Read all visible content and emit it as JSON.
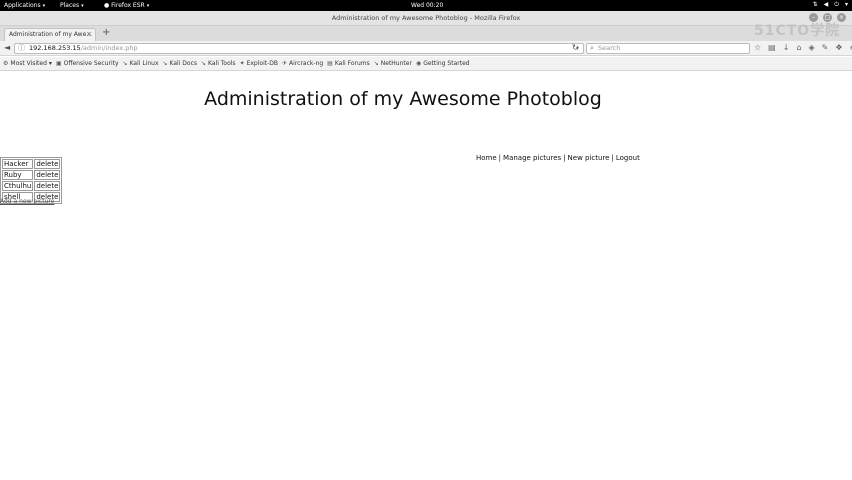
{
  "topbar": {
    "applications": "Applications",
    "places": "Places",
    "app": "Firefox ESR",
    "clock": "Wed 00:20"
  },
  "window": {
    "title": "Administration of my Awesome Photoblog - Mozilla Firefox"
  },
  "tab": {
    "label": "Administration of my Awe..."
  },
  "navbar": {
    "url_host": "192.168.253.15",
    "url_path": "/admin/index.php",
    "search_placeholder": "Search"
  },
  "watermark": "51CTO学院",
  "bookmarks": [
    {
      "label": "Most Visited",
      "icon": "gear-icon"
    },
    {
      "label": "Offensive Security",
      "icon": "offsec-icon"
    },
    {
      "label": "Kali Linux",
      "icon": "kali-icon"
    },
    {
      "label": "Kali Docs",
      "icon": "kali-icon"
    },
    {
      "label": "Kali Tools",
      "icon": "kali-icon"
    },
    {
      "label": "Exploit-DB",
      "icon": "exploitdb-icon"
    },
    {
      "label": "Aircrack-ng",
      "icon": "aircrack-icon"
    },
    {
      "label": "Kali Forums",
      "icon": "forum-icon"
    },
    {
      "label": "NetHunter",
      "icon": "kali-icon"
    },
    {
      "label": "Getting Started",
      "icon": "firefox-icon"
    }
  ],
  "page": {
    "title": "Administration of my Awesome Photoblog",
    "menu": [
      "Home",
      "Manage pictures",
      "New picture",
      "Logout"
    ],
    "pictures": [
      {
        "name": "Hacker",
        "action": "delete"
      },
      {
        "name": "Ruby",
        "action": "delete"
      },
      {
        "name": "Cthulhu",
        "action": "delete"
      },
      {
        "name": "shell",
        "action": "delete"
      }
    ],
    "add_new": "Add a new picture"
  }
}
